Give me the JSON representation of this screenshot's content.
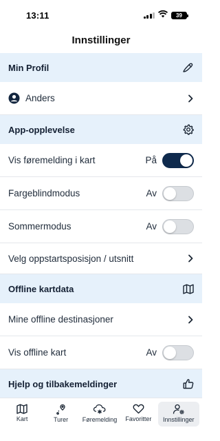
{
  "status_bar": {
    "time": "13:11",
    "battery": "39"
  },
  "page": {
    "title": "Innstillinger"
  },
  "sections": {
    "profile": {
      "title": "Min Profil",
      "user_name": "Anders"
    },
    "app": {
      "title": "App-opplevelse",
      "rows": [
        {
          "label": "Vis føremelding i kart",
          "state": "På",
          "on": true
        },
        {
          "label": "Fargeblindmodus",
          "state": "Av",
          "on": false
        },
        {
          "label": "Sommermodus",
          "state": "Av",
          "on": false
        }
      ],
      "start_position_label": "Velg oppstartsposisjon / utsnitt"
    },
    "offline": {
      "title": "Offline kartdata",
      "destinations_label": "Mine offline destinasjoner",
      "show_offline": {
        "label": "Vis offline kart",
        "state": "Av",
        "on": false
      }
    },
    "help": {
      "title": "Hjelp og tilbakemeldinger"
    }
  },
  "tabbar": {
    "items": [
      {
        "label": "Kart",
        "icon": "map-icon"
      },
      {
        "label": "Turer",
        "icon": "route-icon"
      },
      {
        "label": "Føremelding",
        "icon": "snow-cloud-icon"
      },
      {
        "label": "Favoritter",
        "icon": "heart-icon"
      },
      {
        "label": "Innstillinger",
        "icon": "user-settings-icon",
        "active": true
      }
    ]
  },
  "colors": {
    "section_bg": "#e6f1fb",
    "toggle_on": "#0f2a4d",
    "text": "#1f2b3a"
  }
}
